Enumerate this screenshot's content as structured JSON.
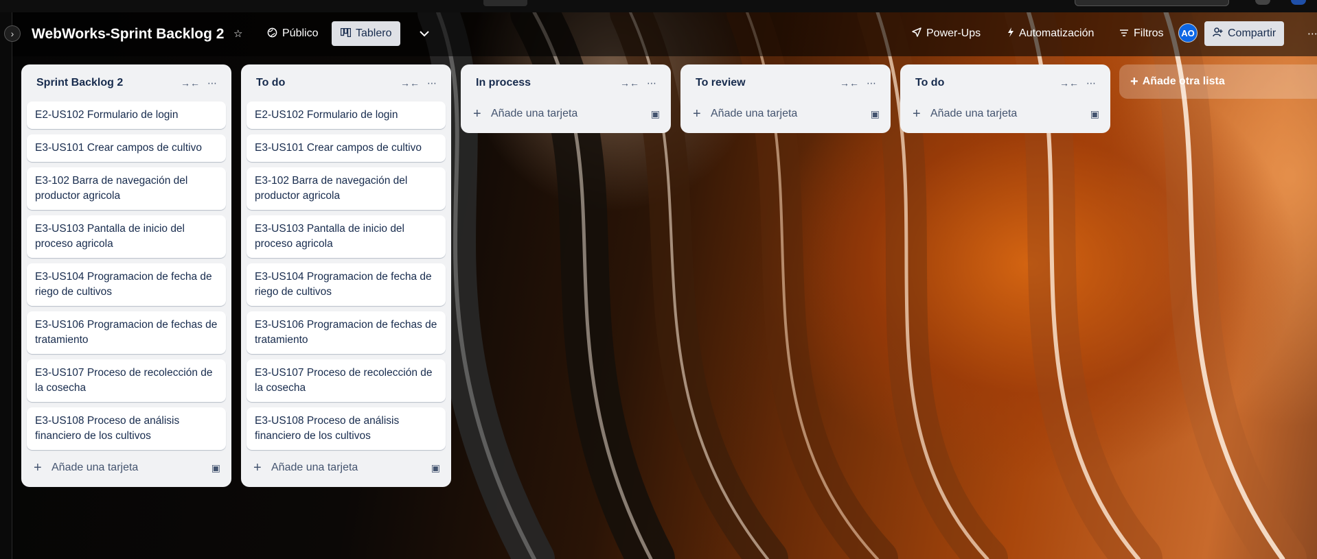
{
  "header": {
    "board_title": "WebWorks-Sprint Backlog 2",
    "visibility_label": "Público",
    "view_label": "Tablero",
    "powerups_label": "Power-Ups",
    "automation_label": "Automatización",
    "filters_label": "Filtros",
    "avatar_initials": "AO",
    "share_label": "Compartir"
  },
  "lists": [
    {
      "title": "Sprint Backlog 2",
      "cards": [
        "E2-US102 Formulario de login",
        "E3-US101 Crear campos de cultivo",
        "E3-102 Barra de navegación del productor agricola",
        "E3-US103 Pantalla de inicio del proceso agricola",
        "E3-US104 Programacion de fecha de riego de cultivos",
        "E3-US106 Programacion de fechas de tratamiento",
        "E3-US107 Proceso de recolección de la cosecha",
        "E3-US108 Proceso de análisis financiero de los cultivos"
      ],
      "add_card_label": "Añade una tarjeta"
    },
    {
      "title": "To do",
      "cards": [
        "E2-US102 Formulario de login",
        "E3-US101 Crear campos de cultivo",
        "E3-102 Barra de navegación del productor agricola",
        "E3-US103 Pantalla de inicio del proceso agricola",
        "E3-US104 Programacion de fecha de riego de cultivos",
        "E3-US106 Programacion de fechas de tratamiento",
        "E3-US107 Proceso de recolección de la cosecha",
        "E3-US108 Proceso de análisis financiero de los cultivos"
      ],
      "add_card_label": "Añade una tarjeta"
    },
    {
      "title": "In process",
      "cards": [],
      "add_card_label": "Añade una tarjeta"
    },
    {
      "title": "To review",
      "cards": [],
      "add_card_label": "Añade una tarjeta"
    },
    {
      "title": "To do",
      "cards": [],
      "add_card_label": "Añade una tarjeta"
    }
  ],
  "add_list_label": "Añade otra lista",
  "icons": {
    "star": "star-icon",
    "public": "globe-icon",
    "board": "board-icon",
    "chevron": "chevron-down-icon",
    "powerups": "rocket-icon",
    "automation": "lightning-icon",
    "filters": "filter-icon",
    "share": "person-add-icon",
    "more": "ellipsis-icon",
    "collapse": "collapse-icon",
    "add": "plus-icon",
    "template": "card-template-icon"
  },
  "colors": {
    "header_overlay": "#000000",
    "list_bg": "#f1f2f4",
    "card_bg": "#ffffff",
    "text": "#172b4d",
    "avatar_bg": "#0c66e4"
  }
}
